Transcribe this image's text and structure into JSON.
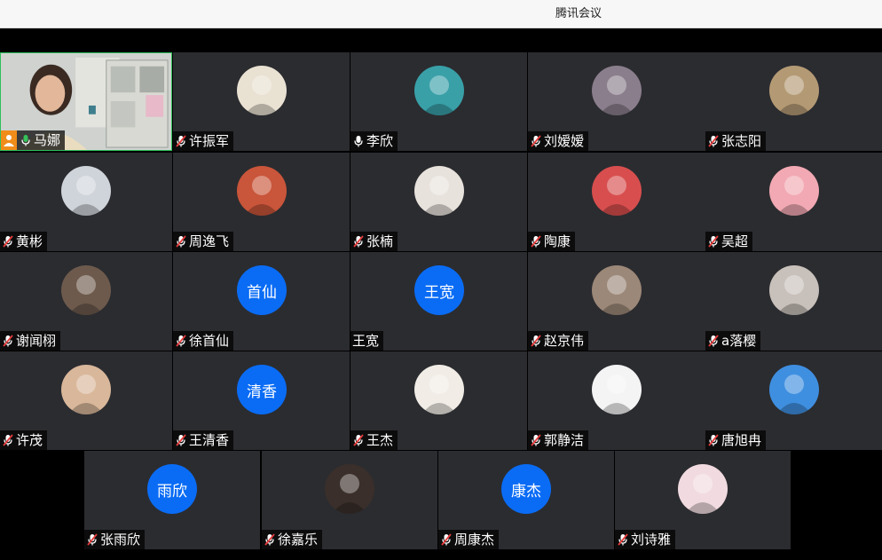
{
  "window": {
    "title": "腾讯会议"
  },
  "participants": [
    {
      "name": "马娜",
      "mic": "on",
      "host": true,
      "video": true,
      "avatar": "video-feed"
    },
    {
      "name": "许振军",
      "mic": "muted",
      "avatar": "text-image",
      "avatar_color": "#e9e1d2"
    },
    {
      "name": "李欣",
      "mic": "on",
      "avatar": "girl-photo",
      "avatar_color": "#39a0a8"
    },
    {
      "name": "刘嫒嫒",
      "mic": "muted",
      "avatar": "character",
      "avatar_color": "#8a7e8c"
    },
    {
      "name": "张志阳",
      "mic": "muted",
      "avatar": "dog-photo",
      "avatar_color": "#b49a74"
    },
    {
      "name": "黄彬",
      "mic": "muted",
      "avatar": "masked-person",
      "avatar_color": "#cfd4da"
    },
    {
      "name": "周逸飞",
      "mic": "muted",
      "avatar": "anime-boy",
      "avatar_color": "#c9553a"
    },
    {
      "name": "张楠",
      "mic": "muted",
      "avatar": "anime-girl",
      "avatar_color": "#e8e2dc"
    },
    {
      "name": "陶康",
      "mic": "muted",
      "avatar": "cartoon-boy",
      "avatar_color": "#d84e4e"
    },
    {
      "name": "吴超",
      "mic": "muted",
      "avatar": "patrick-star",
      "avatar_color": "#f2a9b3"
    },
    {
      "name": "谢闻栩",
      "mic": "muted",
      "avatar": "couple-photo",
      "avatar_color": "#6d5a4c"
    },
    {
      "name": "徐首仙",
      "mic": "muted",
      "avatar": "text",
      "avatar_text": "首仙"
    },
    {
      "name": "王宽",
      "mic": "none",
      "avatar": "text",
      "avatar_text": "王宽"
    },
    {
      "name": "赵京伟",
      "mic": "muted",
      "avatar": "cat-photo",
      "avatar_color": "#9c8878"
    },
    {
      "name": "a落樱",
      "mic": "muted",
      "avatar": "girl-photo-2",
      "avatar_color": "#c8c0ba"
    },
    {
      "name": "许茂",
      "mic": "muted",
      "avatar": "anime-character",
      "avatar_color": "#d9b79a"
    },
    {
      "name": "王清香",
      "mic": "muted",
      "avatar": "text",
      "avatar_text": "清香"
    },
    {
      "name": "王杰",
      "mic": "muted",
      "avatar": "cartoon-face",
      "avatar_color": "#f1ede6"
    },
    {
      "name": "郭静洁",
      "mic": "muted",
      "avatar": "sketch-girl",
      "avatar_color": "#f4f4f4"
    },
    {
      "name": "唐旭冉",
      "mic": "muted",
      "avatar": "cat-sky",
      "avatar_color": "#3f8fe0"
    },
    {
      "name": "张雨欣",
      "mic": "muted",
      "avatar": "text",
      "avatar_text": "雨欣"
    },
    {
      "name": "徐嘉乐",
      "mic": "muted",
      "avatar": "dark-face",
      "avatar_color": "#3a2f2a"
    },
    {
      "name": "周康杰",
      "mic": "muted",
      "avatar": "text",
      "avatar_text": "康杰"
    },
    {
      "name": "刘诗雅",
      "mic": "muted",
      "avatar": "soft-photo",
      "avatar_color": "#f1dbe0"
    }
  ]
}
